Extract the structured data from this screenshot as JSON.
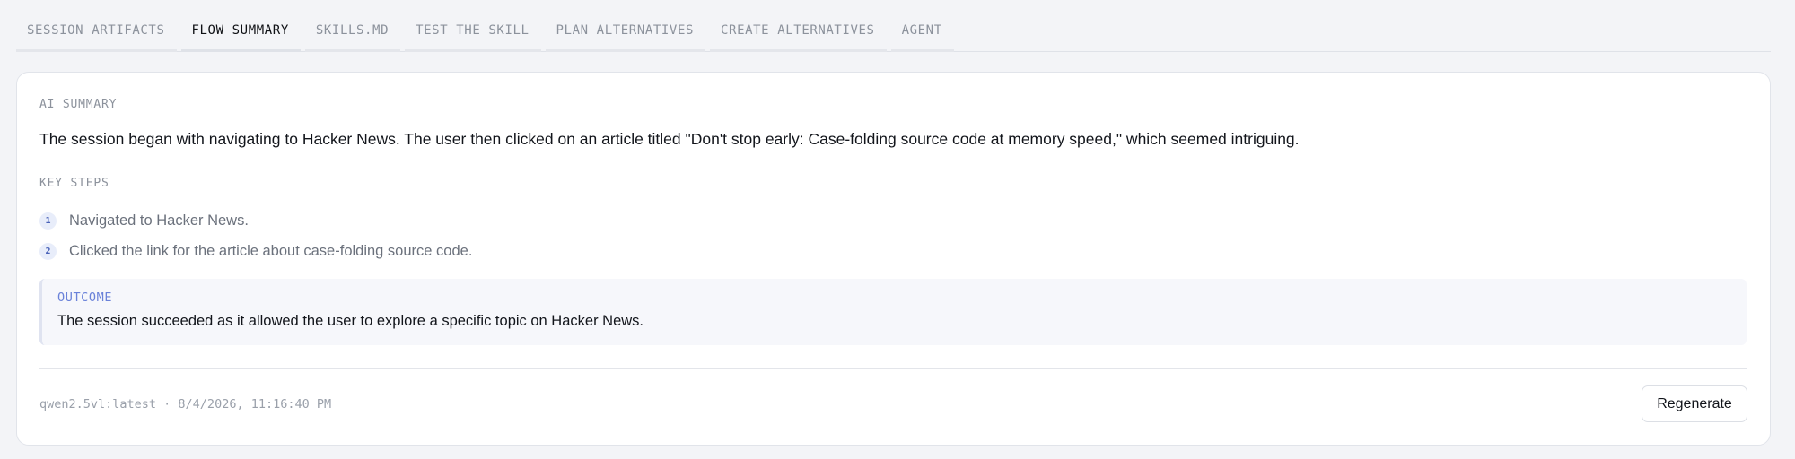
{
  "tabs": [
    {
      "label": "SESSION ARTIFACTS",
      "active": false
    },
    {
      "label": "FLOW SUMMARY",
      "active": true
    },
    {
      "label": "SKILLS.MD",
      "active": false
    },
    {
      "label": "TEST THE SKILL",
      "active": false
    },
    {
      "label": "PLAN ALTERNATIVES",
      "active": false
    },
    {
      "label": "CREATE ALTERNATIVES",
      "active": false
    },
    {
      "label": "AGENT",
      "active": false
    }
  ],
  "summary": {
    "label": "AI SUMMARY",
    "text": "The session began with navigating to Hacker News. The user then clicked on an article titled \"Don't stop early: Case-folding source code at memory speed,\" which seemed intriguing."
  },
  "key_steps": {
    "label": "KEY STEPS",
    "items": [
      {
        "num": "1",
        "text": "Navigated to Hacker News."
      },
      {
        "num": "2",
        "text": "Clicked the link for the article about case-folding source code."
      }
    ]
  },
  "outcome": {
    "label": "OUTCOME",
    "text": "The session succeeded as it allowed the user to explore a specific topic on Hacker News."
  },
  "footer": {
    "meta": "qwen2.5vl:latest · 8/4/2026, 11:16:40 PM",
    "regenerate_label": "Regenerate"
  },
  "colors": {
    "accent": "#6a82d9",
    "background": "#f3f4f7",
    "card": "#ffffff"
  }
}
